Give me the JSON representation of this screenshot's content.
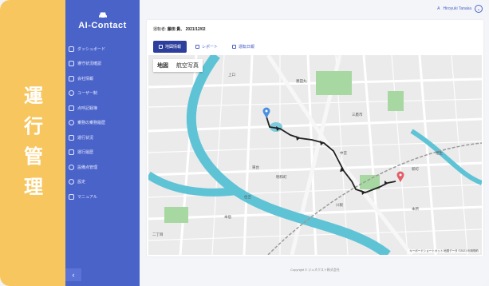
{
  "band": {
    "chars": [
      "運",
      "行",
      "管",
      "理"
    ]
  },
  "logo": {
    "name": "AI-Contact"
  },
  "sidebar": {
    "items": [
      {
        "label": "ダッシュボード",
        "icon": "dashboard-icon"
      },
      {
        "label": "遵守状況確認",
        "icon": "compliance-icon"
      },
      {
        "label": "会社情報",
        "icon": "company-icon"
      },
      {
        "label": "ユーザー制",
        "icon": "user-icon"
      },
      {
        "label": "点呼記録簿",
        "icon": "roll-call-icon"
      },
      {
        "label": "乗務の乗務履歴",
        "icon": "history-icon"
      },
      {
        "label": "運行状況",
        "icon": "operation-icon"
      },
      {
        "label": "運行履歴",
        "icon": "operation-history-icon"
      },
      {
        "label": "設備点管理",
        "icon": "equipment-icon"
      },
      {
        "label": "設定",
        "icon": "settings-icon"
      },
      {
        "label": "マニュアル",
        "icon": "manual-icon"
      }
    ],
    "collapse_label": "‹"
  },
  "header": {
    "user_name": "Hiroyuki Tanaka",
    "user_prefix": "A",
    "chevron": "⌄"
  },
  "card": {
    "driver_label": "運転者:",
    "driver_name": "藤田 貴、",
    "date": "2021/12/02",
    "tabs": [
      {
        "label": "地図情報",
        "active": true,
        "icon": "map-pin-icon"
      },
      {
        "label": "レポート",
        "active": false,
        "icon": "report-icon"
      },
      {
        "label": "運転日報",
        "active": false,
        "icon": "daily-report-icon"
      }
    ]
  },
  "map": {
    "type_buttons": [
      "地図",
      "航空写真"
    ],
    "labels": [
      "上口",
      "墨田丸",
      "三鷹市",
      "東台",
      "明和町",
      "中宮",
      "新町",
      "相生",
      "川駅",
      "本所",
      "本宿",
      "住吉",
      "二丁目"
    ],
    "attribution": "キーボードショートカット  地図データ ©2021  利用規約",
    "colors": {
      "river": "#5fc3d6",
      "park": "#a8d8a2",
      "route": "#222222",
      "start": "#4a90e2",
      "end": "#e35d6a"
    }
  },
  "footer": {
    "text": "Copyright © ジュネクスト株式会社"
  }
}
